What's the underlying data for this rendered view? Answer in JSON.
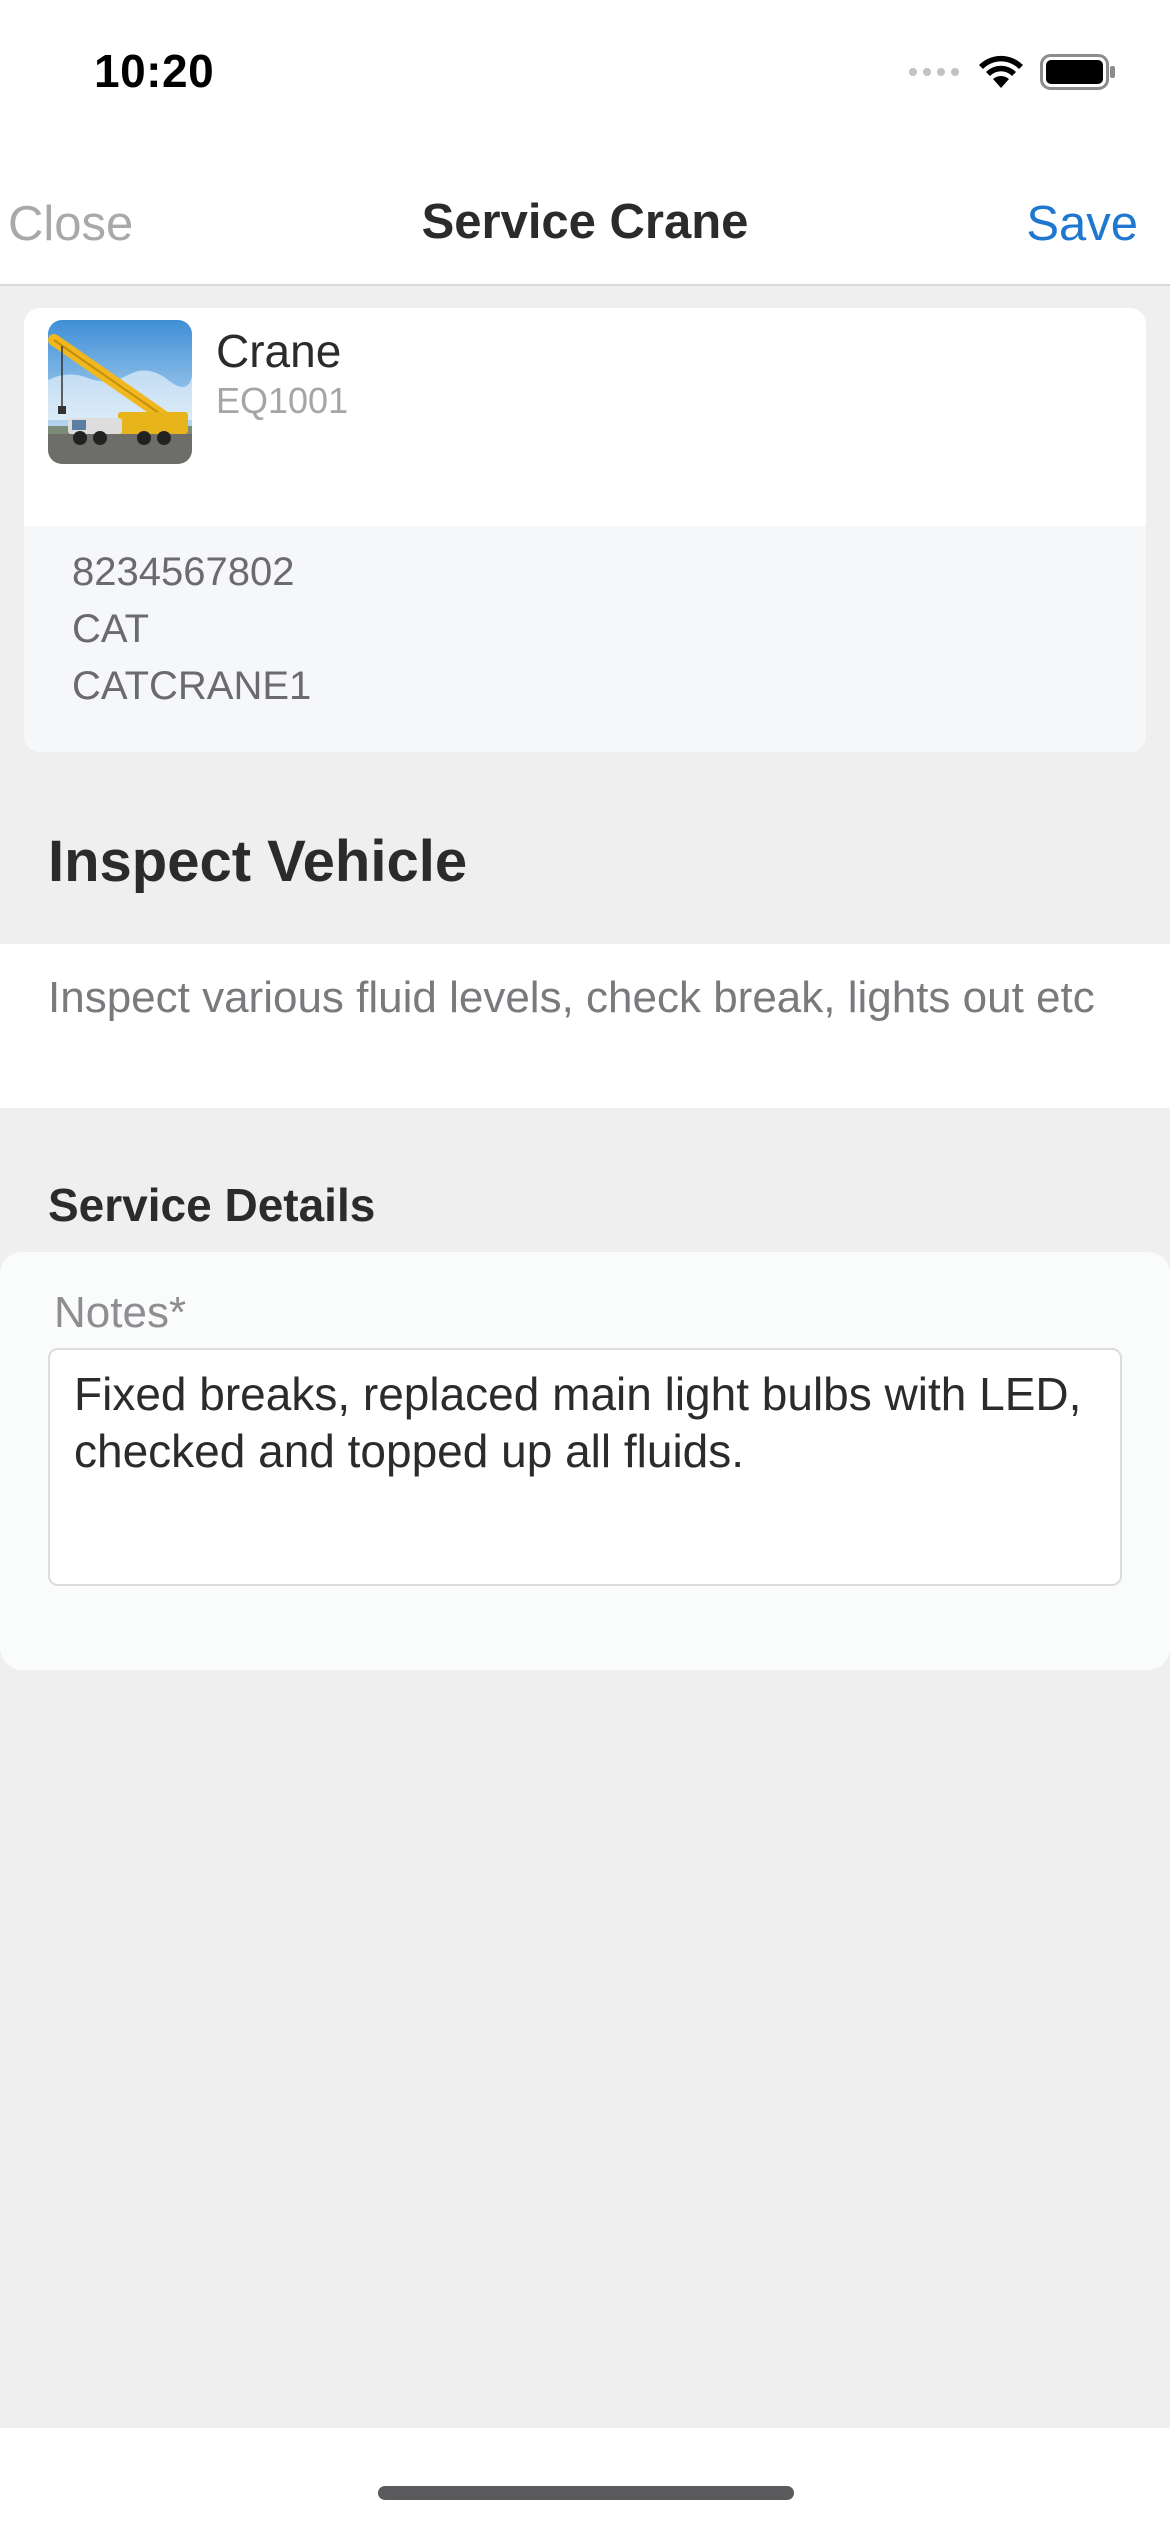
{
  "status_bar": {
    "time": "10:20",
    "icons": [
      "cellular-signal-icon",
      "wifi-icon",
      "battery-icon"
    ]
  },
  "nav": {
    "close_label": "Close",
    "title": "Service Crane",
    "save_label": "Save"
  },
  "equipment": {
    "name": "Crane",
    "id": "EQ1001",
    "thumbnail_icon": "crane-photo",
    "details": [
      "8234567802",
      "CAT",
      "CATCRANE1"
    ]
  },
  "task": {
    "title": "Inspect Vehicle",
    "description": "Inspect various fluid levels, check break, lights out etc"
  },
  "service_details": {
    "heading": "Service Details",
    "notes_label": "Notes*",
    "notes_value": "Fixed breaks, replaced main light bulbs with LED, checked and topped up all fluids."
  },
  "colors": {
    "accent": "#1f77d0",
    "disabled": "#a9a9ab",
    "background": "#efefef"
  }
}
